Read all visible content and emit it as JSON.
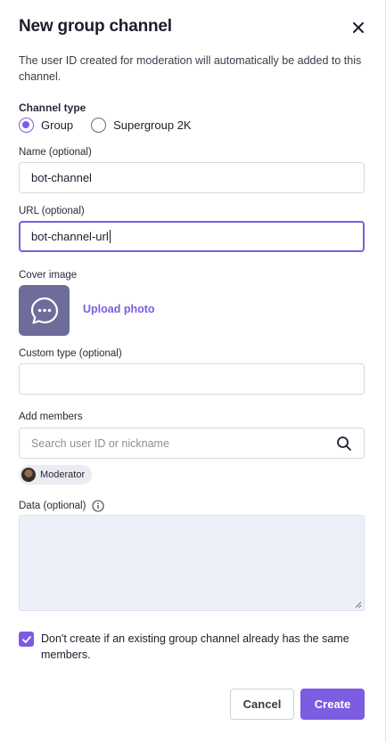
{
  "dialog": {
    "title": "New group channel",
    "description": "The user ID created for moderation will automatically be added to this channel."
  },
  "channel_type": {
    "label": "Channel type",
    "options": [
      {
        "label": "Group",
        "selected": true
      },
      {
        "label": "Supergroup 2K",
        "selected": false
      }
    ]
  },
  "name_field": {
    "label": "Name (optional)",
    "value": "bot-channel"
  },
  "url_field": {
    "label": "URL (optional)",
    "value": "bot-channel-url"
  },
  "cover_image": {
    "label": "Cover image",
    "upload_label": "Upload photo"
  },
  "custom_type_field": {
    "label": "Custom type (optional)",
    "value": ""
  },
  "members": {
    "label": "Add members",
    "search_placeholder": "Search user ID or nickname",
    "chips": [
      {
        "label": "Moderator"
      }
    ]
  },
  "data_field": {
    "label": "Data (optional)",
    "value": ""
  },
  "options": {
    "dont_create_label": "Don't create if an existing group channel already has the same members.",
    "dont_create_checked": true
  },
  "footer": {
    "cancel_label": "Cancel",
    "create_label": "Create"
  },
  "colors": {
    "accent": "#7c5ce0",
    "cover_tile": "#6e6c9a",
    "textarea_bg": "#eef0f9"
  }
}
